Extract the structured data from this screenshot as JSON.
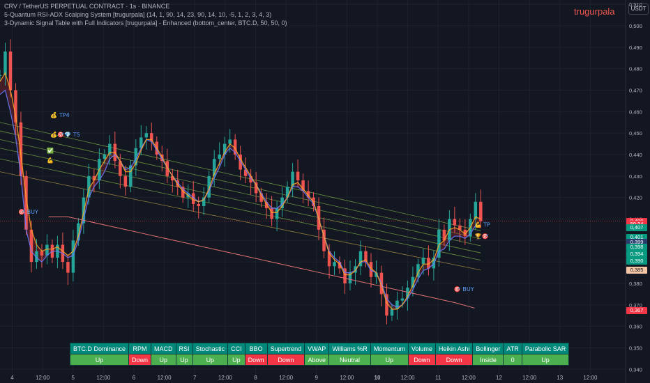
{
  "legend": {
    "symbol": "CRV / TetherUS PERPETUAL CONTRACT · 1s · BINANCE",
    "indicator1": "5-Quantum RSI-ADX Scalping System [trugurpala] (14, 1, 90, 14, 23, 90, 14, 10, -5, 1, 2, 3, 4, 3)",
    "indicator2": "3-Dynamic Signal Table with Full Indicators [trugurpala] - Enhanced (bottom_center, BTC.D, 50, 50, 0)"
  },
  "watermark": "trugurpala",
  "currency": "USDT",
  "colors": {
    "background": "#131722",
    "up": "#26a69a",
    "down": "#ef5350",
    "table_header": "#00897b",
    "table_up": "#4caf50",
    "table_down": "#f23645"
  },
  "price_labels": [
    {
      "text": "0,409",
      "value": 0.409,
      "color": "#f23645"
    },
    {
      "text": "50:34",
      "value": 0.4075,
      "color": "#f23645"
    },
    {
      "text": "0,407",
      "value": 0.406,
      "color": "#089981"
    },
    {
      "text": "0,401",
      "value": 0.4015,
      "color": "#089981"
    },
    {
      "text": "0,399",
      "value": 0.399,
      "color": "#2a3f6e"
    },
    {
      "text": "0,398",
      "value": 0.397,
      "color": "#089981"
    },
    {
      "text": "0,394",
      "value": 0.3935,
      "color": "#089981"
    },
    {
      "text": "0,390",
      "value": 0.3905,
      "color": "#089981"
    },
    {
      "text": "0,385",
      "value": 0.386,
      "color": "#f5c6a5"
    },
    {
      "text": "0,367",
      "value": 0.3672,
      "color": "#f23645"
    }
  ],
  "markers": [
    {
      "emoji": "💰",
      "text": "TP4",
      "x_day": 4.63,
      "y": 0.4575
    },
    {
      "emoji": "💰🎯💎",
      "text": "TS",
      "x_day": 4.63,
      "y": 0.4485
    },
    {
      "emoji": "✅",
      "text": "",
      "x_day": 4.57,
      "y": 0.441
    },
    {
      "emoji": "💪",
      "text": "",
      "x_day": 4.57,
      "y": 0.4365
    },
    {
      "emoji": "🎯",
      "text": "BUY",
      "x_day": 4.1,
      "y": 0.4125
    },
    {
      "emoji": "💪",
      "text": "TP",
      "x_day": 11.6,
      "y": 0.4065
    },
    {
      "emoji": "🏆🎯",
      "text": "",
      "x_day": 11.6,
      "y": 0.401
    },
    {
      "emoji": "🎯",
      "text": "BUY",
      "x_day": 11.26,
      "y": 0.3765
    }
  ],
  "signal_table": {
    "headers": [
      "BTC.D Dominance",
      "RPM",
      "MACD",
      "RSI",
      "Stochastic",
      "CCI",
      "BBO",
      "Supertrend",
      "VWAP",
      "Williams %R",
      "Momentum",
      "Volume",
      "Heikin Ashi",
      "Bollinger",
      "ATR",
      "Parabolic SAR"
    ],
    "values": [
      "Up",
      "Down",
      "Up",
      "Up",
      "Up",
      "Up",
      "Down",
      "Down",
      "Above",
      "Neutral",
      "Up",
      "Down",
      "Down",
      "Inside",
      "0",
      "Up"
    ],
    "status": [
      "up",
      "down",
      "up",
      "up",
      "up",
      "up",
      "down",
      "down",
      "up",
      "up",
      "up",
      "down",
      "down",
      "up",
      "up",
      "up"
    ]
  },
  "chart_data": {
    "type": "candlestick",
    "title": "CRV / TetherUS PERPETUAL CONTRACT · 1s · BINANCE",
    "y_ticks": [
      "0,510",
      "0,500",
      "0,490",
      "0,480",
      "0,470",
      "0,460",
      "0,450",
      "0,440",
      "0,430",
      "0,420",
      "0,410",
      "0,400",
      "0,390",
      "0,380",
      "0,370",
      "0,360",
      "0,350",
      "0,340"
    ],
    "ylim": [
      0.3375,
      0.512
    ],
    "x_ticks": [
      "4",
      "12:00",
      "5",
      "12:00",
      "6",
      "12:00",
      "7",
      "12:00",
      "8",
      "12:00",
      "9",
      "12:00",
      "10",
      "12:00",
      "11",
      "12:00",
      "12",
      "12:00",
      "13",
      "12:00"
    ],
    "x_tick_days": [
      4,
      4.5,
      5,
      5.5,
      6,
      6.5,
      7,
      7.5,
      8,
      8.5,
      9,
      9.5,
      10,
      10.5,
      11,
      11.5,
      12,
      12.5,
      13,
      13.5
    ],
    "xlim_days": [
      3.8,
      14.08
    ],
    "closes": [
      0.477,
      0.488,
      0.47,
      0.455,
      0.43,
      0.405,
      0.39,
      0.395,
      0.393,
      0.398,
      0.392,
      0.398,
      0.39,
      0.385,
      0.4,
      0.408,
      0.42,
      0.43,
      0.428,
      0.438,
      0.44,
      0.445,
      0.437,
      0.43,
      0.425,
      0.435,
      0.443,
      0.448,
      0.45,
      0.446,
      0.44,
      0.437,
      0.43,
      0.428,
      0.425,
      0.42,
      0.422,
      0.417,
      0.416,
      0.42,
      0.43,
      0.438,
      0.44,
      0.445,
      0.447,
      0.44,
      0.433,
      0.43,
      0.427,
      0.422,
      0.418,
      0.415,
      0.41,
      0.415,
      0.42,
      0.425,
      0.432,
      0.428,
      0.423,
      0.42,
      0.416,
      0.405,
      0.395,
      0.388,
      0.39,
      0.387,
      0.38,
      0.385,
      0.388,
      0.395,
      0.39,
      0.383,
      0.385,
      0.375,
      0.365,
      0.368,
      0.372,
      0.373,
      0.378,
      0.383,
      0.389,
      0.392,
      0.387,
      0.392,
      0.405,
      0.4,
      0.41,
      0.407,
      0.405,
      0.402,
      0.41,
      0.418,
      0.409
    ],
    "series": [
      {
        "name": "",
        "color": "#6b7bff",
        "values": [
          0.468,
          0.47,
          0.46,
          0.448,
          0.43,
          0.405,
          0.395,
          0.392,
          0.39,
          0.393,
          0.395,
          0.395,
          0.394,
          0.392,
          0.393,
          0.4,
          0.41,
          0.42,
          0.425,
          0.428,
          0.432,
          0.438,
          0.44,
          0.437,
          0.433,
          0.434,
          0.438,
          0.443,
          0.447,
          0.446,
          0.442,
          0.438,
          0.434,
          0.43,
          0.427,
          0.424,
          0.422,
          0.42,
          0.418,
          0.419,
          0.423,
          0.429,
          0.434,
          0.44,
          0.443,
          0.441,
          0.437,
          0.433,
          0.429,
          0.426,
          0.422,
          0.418,
          0.415,
          0.415,
          0.417,
          0.42,
          0.425,
          0.425,
          0.423,
          0.42,
          0.417,
          0.41,
          0.402,
          0.395,
          0.392,
          0.39,
          0.385,
          0.385,
          0.386,
          0.39,
          0.39,
          0.386,
          0.385,
          0.38,
          0.373,
          0.37,
          0.369,
          0.37,
          0.373,
          0.377,
          0.382,
          0.386,
          0.387,
          0.389,
          0.395,
          0.396,
          0.4,
          0.402,
          0.402,
          0.401,
          0.403,
          0.407,
          0.407
        ]
      },
      {
        "name": "",
        "color": "#ffa726",
        "values": [
          0.474,
          0.478,
          0.47,
          0.458,
          0.44,
          0.42,
          0.405,
          0.398,
          0.395,
          0.396,
          0.396,
          0.397,
          0.395,
          0.393,
          0.395,
          0.402,
          0.413,
          0.424,
          0.428,
          0.433,
          0.437,
          0.441,
          0.441,
          0.437,
          0.432,
          0.432,
          0.436,
          0.442,
          0.447,
          0.447,
          0.443,
          0.439,
          0.434,
          0.43,
          0.426,
          0.423,
          0.421,
          0.419,
          0.418,
          0.419,
          0.424,
          0.431,
          0.436,
          0.441,
          0.445,
          0.443,
          0.438,
          0.434,
          0.43,
          0.426,
          0.421,
          0.417,
          0.413,
          0.413,
          0.416,
          0.42,
          0.426,
          0.427,
          0.424,
          0.421,
          0.418,
          0.41,
          0.402,
          0.394,
          0.391,
          0.389,
          0.384,
          0.384,
          0.386,
          0.39,
          0.391,
          0.387,
          0.385,
          0.379,
          0.371,
          0.368,
          0.368,
          0.37,
          0.374,
          0.379,
          0.385,
          0.389,
          0.389,
          0.391,
          0.398,
          0.4,
          0.405,
          0.406,
          0.405,
          0.403,
          0.406,
          0.411,
          0.41
        ]
      },
      {
        "name": "",
        "color": "#e57373",
        "values": [
          0.411,
          0.411,
          0.409,
          0.407,
          0.405,
          0.403,
          0.401,
          0.399,
          0.397,
          0.395,
          0.393,
          0.391,
          0.389,
          0.387,
          0.385,
          0.383,
          0.381,
          0.379,
          0.377,
          0.375,
          0.373,
          0.371,
          0.3685
        ]
      }
    ]
  }
}
